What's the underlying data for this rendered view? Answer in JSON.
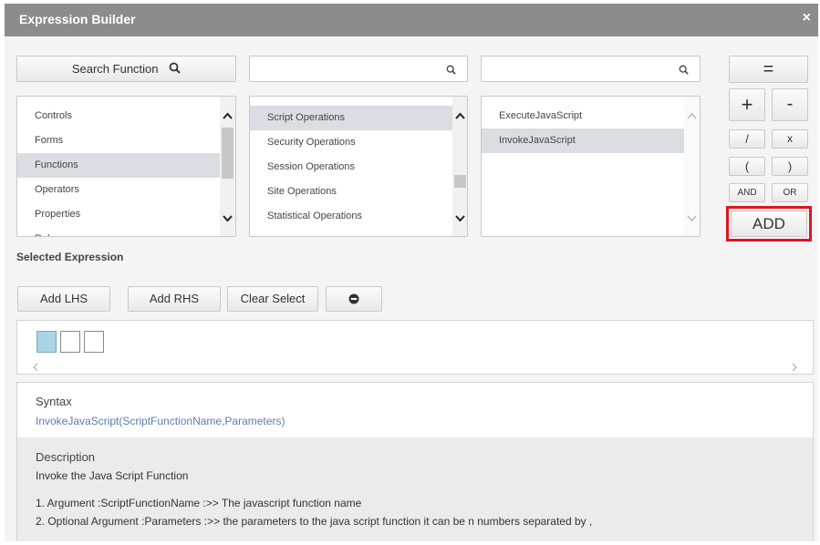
{
  "dialog": {
    "title": "Expression Builder",
    "close_glyph": "×"
  },
  "search": {
    "button_label": "Search Function",
    "input2_value": "",
    "input3_value": ""
  },
  "lists": {
    "categories": {
      "items": [
        "Controls",
        "Forms",
        "Functions",
        "Operators",
        "Properties",
        "Rules"
      ],
      "selected": "Functions"
    },
    "function_groups": {
      "items": [
        "Script Operations",
        "Security Operations",
        "Session Operations",
        "Site Operations",
        "Statistical Operations"
      ],
      "selected": "Script Operations"
    },
    "functions": {
      "items": [
        "ExecuteJavaScript",
        "InvokeJavaScript"
      ],
      "selected": "InvokeJavaScript"
    }
  },
  "operators": {
    "equals": "=",
    "plus": "+",
    "minus": "-",
    "divide": "/",
    "multiply": "x",
    "open_paren": "(",
    "close_paren": ")",
    "and": "AND",
    "or": "OR",
    "add": "ADD"
  },
  "selected_expression": {
    "label": "Selected Expression",
    "add_lhs": "Add LHS",
    "add_rhs": "Add RHS",
    "clear_select": "Clear Select",
    "remove_icon": "minus-circle-icon"
  },
  "syntax": {
    "heading": "Syntax",
    "value": "InvokeJavaScript(ScriptFunctionName,Parameters)"
  },
  "description": {
    "heading": "Description",
    "summary": "Invoke the Java Script Function",
    "arg1": "1. Argument :ScriptFunctionName :>> The javascript function name",
    "arg2": "2. Optional Argument :Parameters :>> the parameters to the java script function it can be n numbers separated by ,"
  },
  "colors": {
    "titlebar": "#8c8c8c",
    "highlight_border": "#e0151f",
    "selected_row": "#dcdde2",
    "active_slot": "#a8d4e3",
    "link": "#5b7cb8"
  }
}
